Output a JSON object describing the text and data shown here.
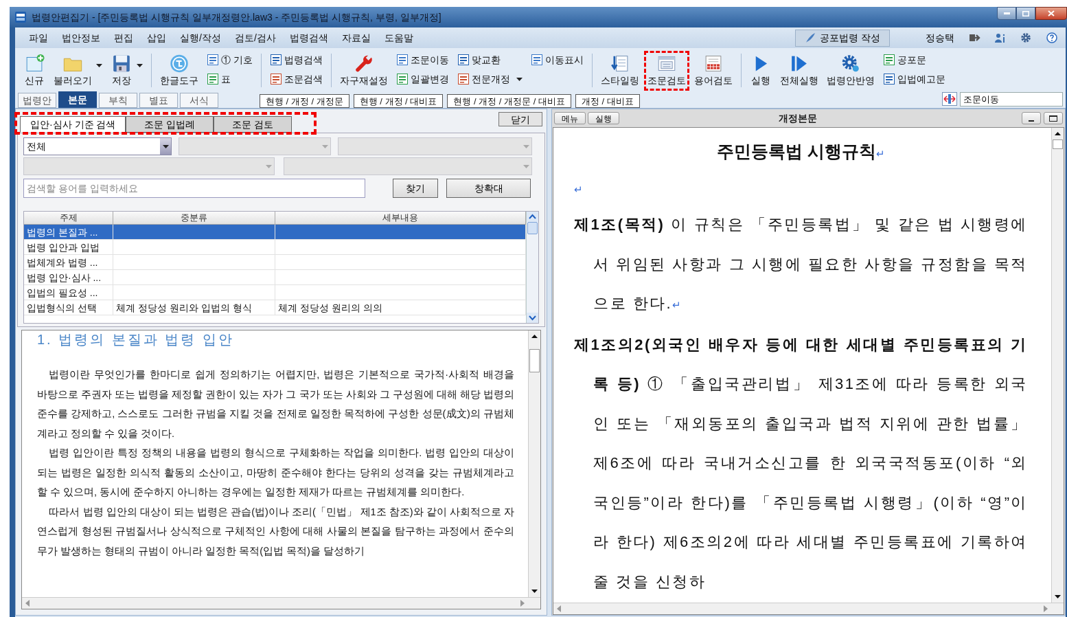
{
  "window": {
    "title": "법령안편집기 - [주민등록법 시행규칙 일부개정령안.law3 -  주민등록법 시행규칙, 부령, 일부개정]"
  },
  "menu": [
    "파일",
    "법안정보",
    "편집",
    "삽입",
    "실행/작성",
    "검토/검사",
    "법령검색",
    "자료실",
    "도움말"
  ],
  "menu_right": {
    "button": "공포법령 작성",
    "user": "정승택"
  },
  "toolbar": [
    {
      "kind": "large",
      "label": "신규",
      "dropdown": false,
      "highlighted": false
    },
    {
      "kind": "large",
      "label": "불러오기",
      "dropdown": true,
      "highlighted": false
    },
    {
      "kind": "large",
      "label": "저장",
      "dropdown": true,
      "highlighted": false
    },
    {
      "kind": "separator"
    },
    {
      "kind": "large",
      "label": "한글도구",
      "dropdown": false,
      "highlighted": false
    },
    {
      "kind": "stack",
      "items": [
        {
          "label": "① 기호",
          "dropdown": false
        },
        {
          "label": "표",
          "dropdown": false
        }
      ]
    },
    {
      "kind": "separator"
    },
    {
      "kind": "stack",
      "items": [
        {
          "label": "법령검색",
          "dropdown": false
        },
        {
          "label": "조문검색",
          "dropdown": false
        }
      ]
    },
    {
      "kind": "separator"
    },
    {
      "kind": "large",
      "label": "자구재설정",
      "dropdown": false,
      "highlighted": false
    },
    {
      "kind": "stack",
      "items": [
        {
          "label": "조문이동",
          "dropdown": false
        },
        {
          "label": "일괄변경",
          "dropdown": false
        }
      ]
    },
    {
      "kind": "stack",
      "items": [
        {
          "label": "맞교환",
          "dropdown": false
        },
        {
          "label": "전문개정",
          "dropdown": true
        }
      ]
    },
    {
      "kind": "stack",
      "items": [
        {
          "label": "이동표시",
          "dropdown": false
        }
      ]
    },
    {
      "kind": "separator"
    },
    {
      "kind": "large",
      "label": "스타일링",
      "dropdown": false,
      "highlighted": false
    },
    {
      "kind": "large",
      "label": "조문검토",
      "dropdown": false,
      "highlighted": true
    },
    {
      "kind": "large",
      "label": "용어검토",
      "dropdown": false,
      "highlighted": false
    },
    {
      "kind": "separator"
    },
    {
      "kind": "large",
      "label": "실행",
      "dropdown": false,
      "highlighted": false
    },
    {
      "kind": "large",
      "label": "전체실행",
      "dropdown": false,
      "highlighted": false
    },
    {
      "kind": "large",
      "label": "법령안반영",
      "dropdown": false,
      "highlighted": false
    },
    {
      "kind": "stack",
      "items": [
        {
          "label": "공포문",
          "dropdown": false
        },
        {
          "label": "입법예고문",
          "dropdown": false
        }
      ]
    }
  ],
  "section_tabs": [
    {
      "label": "법령안",
      "selected": false
    },
    {
      "label": "본문",
      "selected": true
    },
    {
      "label": "부칙",
      "selected": false
    },
    {
      "label": "별표",
      "selected": false
    },
    {
      "label": "서식",
      "selected": false
    }
  ],
  "view_tabs": [
    {
      "label": "현행 / 개정 / 개정문",
      "selected": false
    },
    {
      "label": "현행 / 개정 / 대비표",
      "selected": false
    },
    {
      "label": "현행 / 개정 / 개정문 / 대비표",
      "selected": false
    },
    {
      "label": "개정 / 대비표",
      "selected": false
    }
  ],
  "jump_field": {
    "value": "조문이동"
  },
  "left_panel": {
    "tabs_highlighted": true,
    "tabs": [
      {
        "label": "입안·심사 기준 검색",
        "selected": true
      },
      {
        "label": "조문 입법례",
        "selected": false
      },
      {
        "label": "조문 검토",
        "selected": false
      }
    ],
    "close_button": "닫기",
    "filters": [
      {
        "value": "전체",
        "disabled": false
      },
      {
        "disabled": true
      },
      {
        "disabled": true
      },
      {
        "disabled": true
      },
      {
        "disabled": true
      }
    ],
    "search": {
      "placeholder": "검색할 용어를 입력하세요"
    },
    "buttons": [
      "찾기",
      "창확대"
    ],
    "table": {
      "columns": [
        "주제",
        "중분류",
        "세부내용"
      ],
      "rows": [
        {
          "cells": [
            "법령의 본질과 ...",
            "",
            ""
          ],
          "selected": true
        },
        {
          "cells": [
            "법령 입안과 입법",
            "",
            ""
          ],
          "selected": false
        },
        {
          "cells": [
            "법체계와 법령 ...",
            "",
            ""
          ],
          "selected": false
        },
        {
          "cells": [
            "법령 입안·심사 ...",
            "",
            ""
          ],
          "selected": false
        },
        {
          "cells": [
            "입법의 필요성 ...",
            "",
            ""
          ],
          "selected": false
        },
        {
          "cells": [
            "입법형식의 선택",
            "체계 정당성 원리와 입법의 형식",
            "체계 정당성 원리의 의의"
          ],
          "selected": false
        }
      ]
    },
    "document": {
      "heading": "1. 법령의 본질과 법령 입안",
      "paragraphs": [
        "법령이란 무엇인가를 한마디로 쉽게 정의하기는 어렵지만, 법령은 기본적으로 국가적·사회적 배경을 바탕으로 주권자 또는 법령을 제정할 권한이 있는 자가 그 국가 또는 사회와 그 구성원에 대해 해당 법령의 준수를 강제하고, 스스로도 그러한 규범을 지킬 것을 전제로 일정한 목적하에 구성한 성문(成文)의 규범체계라고 정의할 수 있을 것이다.",
        "법령 입안이란 특정 정책의 내용을 법령의 형식으로 구체화하는 작업을 의미한다. 법령 입안의 대상이 되는 법령은 일정한 의식적 활동의 소산이고, 마땅히 준수해야 한다는 당위의 성격을 갖는 규범체계라고 할 수 있으며, 동시에 준수하지 아니하는 경우에는 일정한 제재가 따르는 규범체계를 의미한다.",
        "따라서 법령 입안의 대상이 되는 법령은 관습(법)이나 조리(「민법」 제1조 참조)와 같이 사회적으로 자연스럽게 형성된 규범질서나 상식적으로 구체적인 사항에 대해 사물의 본질을 탐구하는 과정에서 준수의무가 발생하는 형태의 규범이 아니라 일정한 목적(입법 목적)을 달성하기"
      ]
    }
  },
  "right_panel": {
    "buttons": [
      "메뉴",
      "실행"
    ],
    "title": "개정본문",
    "document": {
      "title": "주민등록법 시행규칙",
      "title_mark": "↵",
      "blank_mark": "↵",
      "articles": [
        {
          "text": "**제1조(목적)** 이 규칙은 「주민등록법」 및 같은 법 시행령에서 위임된 사항과 그 시행에 필요한 사항을 규정함을 목적으로 한다.",
          "end_mark": "↵"
        },
        {
          "text": "**제1조의2(외국인 배우자 등에 대한 세대별 주민등록표의 기록 등)** ① 「출입국관리법」 제31조에 따라 등록한 외국인 또는 「재외동포의 출입국과 법적 지위에 관한 법률」 제6조에 따라 국내거소신고를 한 외국국적동포(이하 “외국인등”이라 한다)를 「주민등록법 시행령」(이하 “영”이라 한다) 제6조의2에 따라 세대별 주민등록표에 기록하여 줄 것을 신청하"
        }
      ]
    }
  }
}
